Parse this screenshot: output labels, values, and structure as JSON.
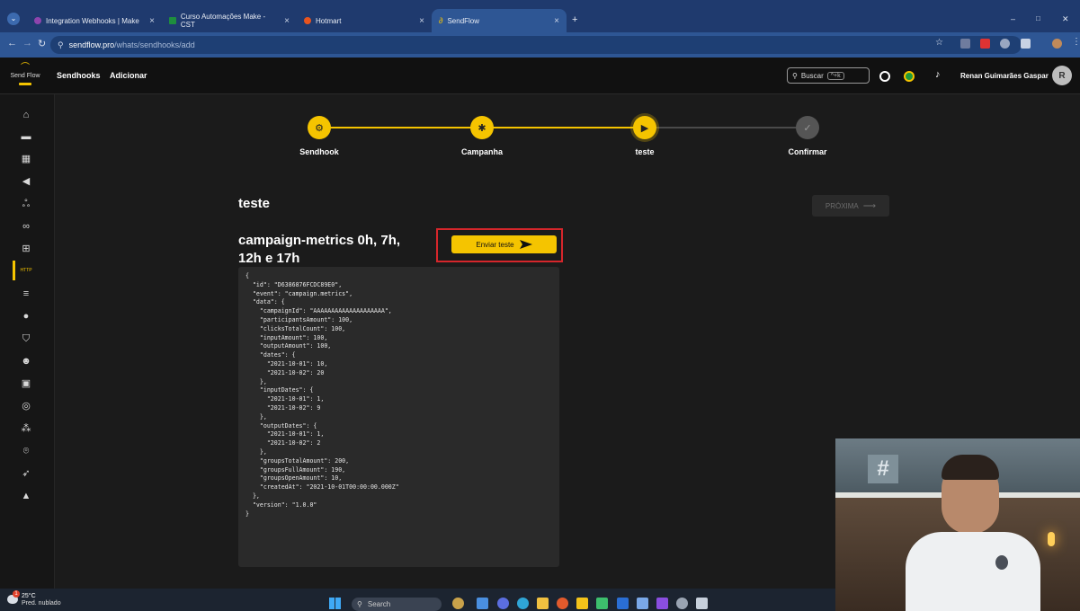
{
  "browser": {
    "tabs": [
      {
        "label": "Integration Webhooks | Make",
        "icon_color": "#8e44ad"
      },
      {
        "label": "Curso Automações Make - CST",
        "icon_color": "#1e8e3e"
      },
      {
        "label": "Hotmart",
        "icon_color": "#e8541e"
      },
      {
        "label": "SendFlow",
        "icon_color": "#f5c400"
      }
    ],
    "new_tab": "+",
    "url_host": "sendflow.pro",
    "url_path": "/whats/sendhooks/add",
    "window_controls": [
      "–",
      "□",
      "✕"
    ]
  },
  "header": {
    "logo": "Send Flow",
    "breadcrumb": [
      "Sendhooks",
      "Adicionar"
    ],
    "search_label": "Buscar",
    "search_shortcut": "^+k",
    "user_name": "Renan Guimarães Gaspar",
    "avatar_initial": "R"
  },
  "sidebar": {
    "icons": [
      "home-icon",
      "folder-icon",
      "qr-code-icon",
      "megaphone-icon",
      "webhook-icon",
      "link-icon",
      "flow-icon",
      "http-icon",
      "list-icon",
      "info-icon",
      "shield-icon",
      "bot-icon",
      "message-icon",
      "broadcast-icon",
      "group-icon",
      "signal-icon",
      "rocket-icon",
      "school-icon"
    ],
    "http_label": "HTTP"
  },
  "stepper": {
    "steps": [
      {
        "label": "Sendhook",
        "icon": "webhook-icon",
        "glyph": "⚙",
        "status": "done"
      },
      {
        "label": "Campanha",
        "icon": "megaphone-icon",
        "glyph": "✱",
        "status": "done"
      },
      {
        "label": "teste",
        "icon": "play-icon",
        "glyph": "▶",
        "status": "active"
      },
      {
        "label": "Confirmar",
        "icon": "check-icon",
        "glyph": "✓",
        "status": "pending"
      }
    ]
  },
  "main": {
    "section_title": "teste",
    "event_title": "campaign-metrics 0h, 7h, 12h e 17h",
    "send_test_label": "Enviar teste",
    "next_label": "PRÓXIMA",
    "payload": "{\n  \"id\": \"D6386876FCDC89E0\",\n  \"event\": \"campaign.metrics\",\n  \"data\": {\n    \"campaignId\": \"AAAAAAAAAAAAAAAAAAAA\",\n    \"participantsAmount\": 100,\n    \"clicksTotalCount\": 100,\n    \"inputAmount\": 100,\n    \"outputAmount\": 100,\n    \"dates\": {\n      \"2021-10-01\": 10,\n      \"2021-10-02\": 20\n    },\n    \"inputDates\": {\n      \"2021-10-01\": 1,\n      \"2021-10-02\": 9\n    },\n    \"outputDates\": {\n      \"2021-10-01\": 1,\n      \"2021-10-02\": 2\n    },\n    \"groupsTotalAmount\": 200,\n    \"groupsFullAmount\": 190,\n    \"groupsOpenAmount\": 10,\n    \"createdAt\": \"2021-10-01T00:00:00.000Z\"\n  },\n  \"version\": \"1.0.0\"\n}"
  },
  "taskbar": {
    "temperature": "25°C",
    "weather": "Pred. nublado",
    "notification_count": "1",
    "search_placeholder": "Search"
  },
  "colors": {
    "accent": "#f5c400",
    "highlight_box": "#d6262b",
    "chrome": "#2e5694"
  }
}
